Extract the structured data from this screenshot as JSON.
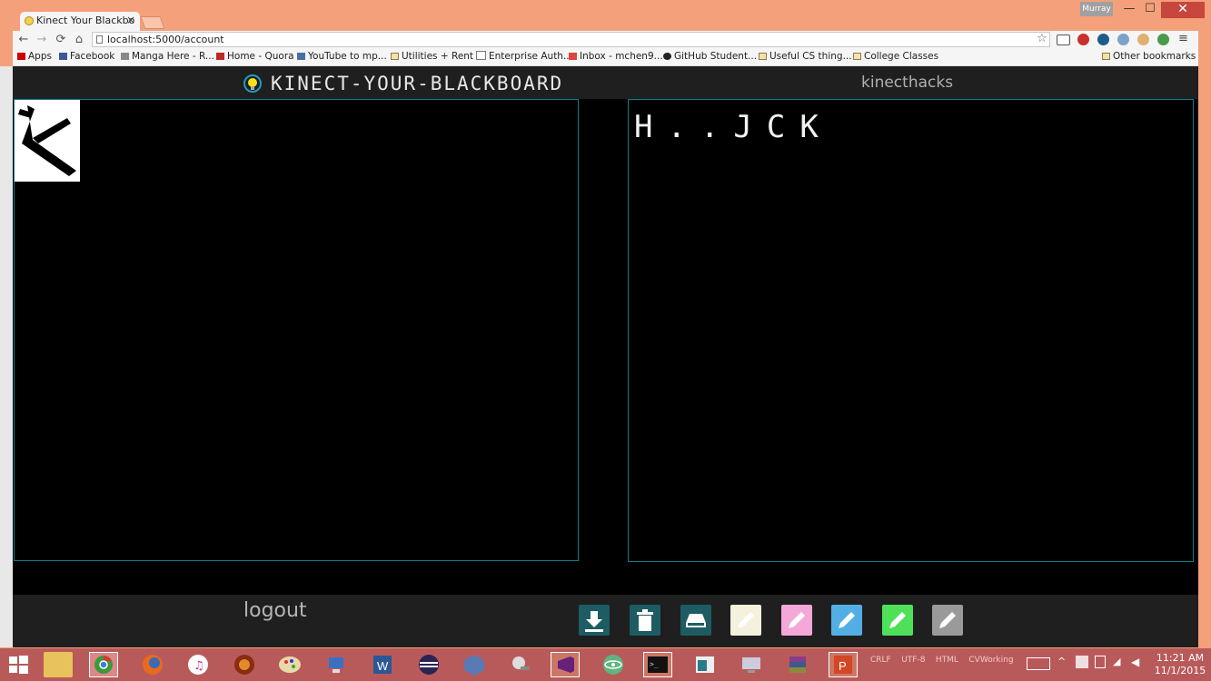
{
  "browser": {
    "tab_title": "Kinect Your Blackbo",
    "tab_close": "×",
    "user": "Murray",
    "window_controls": {
      "minimize": "—",
      "maximize": "☐",
      "close": "✕"
    },
    "nav": {
      "back": "←",
      "forward": "→",
      "reload": "⟳",
      "home": "⌂"
    },
    "url": "localhost:5000/account",
    "bookmarks": [
      "Apps",
      "Facebook",
      "Manga Here - R...",
      "Home - Quora",
      "YouTube to mp...",
      "Utilities + Rent",
      "Enterprise Auth...",
      "Inbox - mchen9...",
      "GitHub Student...",
      "Useful CS thing...",
      "College Classes"
    ],
    "other_bookmarks": "Other bookmarks"
  },
  "app": {
    "title": "KINECT-YOUR-BLACKBOARD",
    "brand": "kinecthacks",
    "recognized_text": "H..JCK",
    "logout": "logout",
    "tools": [
      {
        "name": "download",
        "color": "#1d5c63"
      },
      {
        "name": "trash",
        "color": "#1d5c63"
      },
      {
        "name": "eraser",
        "color": "#1d5c63"
      },
      {
        "name": "pencil-cream",
        "color": "#f4f1dc"
      },
      {
        "name": "pencil-pink",
        "color": "#f4a8d8"
      },
      {
        "name": "pencil-blue",
        "color": "#54aee6"
      },
      {
        "name": "pencil-green",
        "color": "#4fe05a"
      },
      {
        "name": "pencil-gray",
        "color": "#9a9a9a"
      }
    ]
  },
  "taskbar": {
    "tray_labels": [
      "CRLF",
      "UTF-8",
      "HTML",
      "CVWorking"
    ],
    "time": "11:21 AM",
    "date": "11/1/2015"
  }
}
